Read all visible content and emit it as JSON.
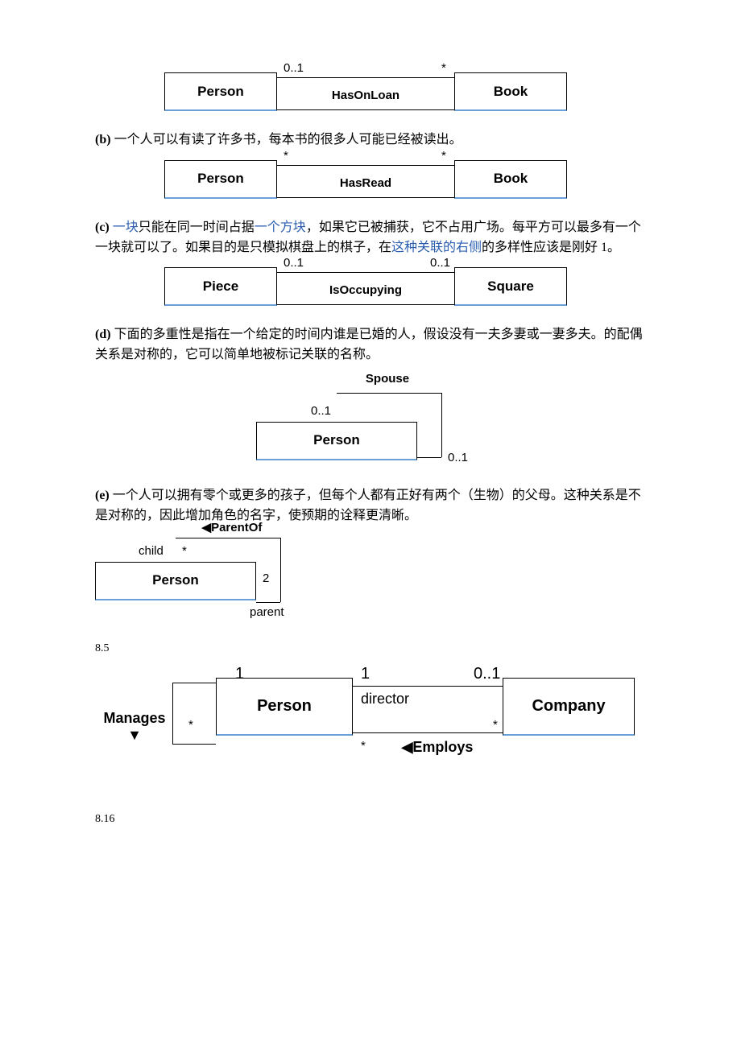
{
  "diagrams": {
    "a": {
      "left_class": "Person",
      "right_class": "Book",
      "assoc_name": "HasOnLoan",
      "left_mult": "0..1",
      "right_mult": "*"
    },
    "b_text_label": "(b)",
    "b_text": " 一个人可以有读了许多书，每本书的很多人可能已经被读出。",
    "b": {
      "left_class": "Person",
      "right_class": "Book",
      "assoc_name": "HasRead",
      "left_mult": "*",
      "right_mult": "*"
    },
    "c_text_label": "(c)",
    "c_text_parts": {
      "p1": " ",
      "link1": "一块",
      "p2": "只能在同一时间占据",
      "link2": "一个方块",
      "p3": "，如果它已被捕获，它不占用广场。每平方可以最多有一个一块就可以了。如果目的是只模拟棋盘上的棋子，在",
      "link3": "这种关联的右侧",
      "p4": "的多样性应该是刚好 1。"
    },
    "c": {
      "left_class": "Piece",
      "right_class": "Square",
      "assoc_name": "IsOccupying",
      "left_mult": "0..1",
      "right_mult": "0..1"
    },
    "d_text_label": "(d)",
    "d_text": " 下面的多重性是指在一个给定的时间内谁是已婚的人，假设没有一夫多妻或一妻多夫。的配偶关系是对称的，它可以简单地被标记关联的名称。",
    "d": {
      "class": "Person",
      "assoc_name": "Spouse",
      "top_mult": "0..1",
      "bottom_mult": "0..1"
    },
    "e_text_label": "(e)",
    "e_text": " 一个人可以拥有零个或更多的孩子，但每个人都有正好有两个（生物）的父母。这种关系是不是对称的，因此增加角色的名字，使预期的诠释更清晰。",
    "e": {
      "class": "Person",
      "assoc_name": "◀ParentOf",
      "child_role": "child",
      "child_mult": "*",
      "parent_role": "parent",
      "parent_mult": "2"
    },
    "sec85_label": "8.5",
    "f": {
      "left_class": "Person",
      "right_class": "Company",
      "manages_name": "Manages ▼",
      "manages_top_mult": "1",
      "manages_bottom_mult": "*",
      "director_role": "director",
      "director_left_mult": "1",
      "director_right_mult": "0..1",
      "employs_name": "◀Employs",
      "employs_left_mult": "*",
      "employs_right_mult": "*"
    },
    "sec816_label": "8.16"
  }
}
